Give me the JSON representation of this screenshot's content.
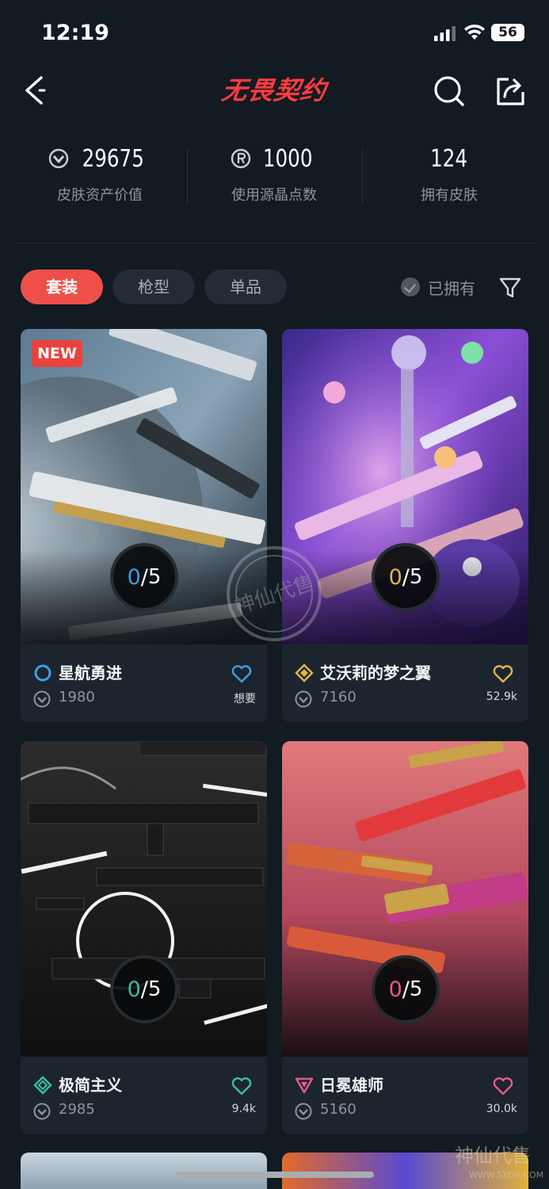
{
  "status_bar": {
    "time": "12:19",
    "battery": "56"
  },
  "header": {
    "title": "无畏契约"
  },
  "stats": [
    {
      "value": "29675",
      "label": "皮肤资产价值",
      "icon": "vp-coin-icon"
    },
    {
      "value": "1000",
      "label": "使用源晶点数",
      "icon": "radianite-icon"
    },
    {
      "value": "124",
      "label": "拥有皮肤",
      "icon": ""
    }
  ],
  "tabs": [
    {
      "label": "套装",
      "active": true
    },
    {
      "label": "枪型",
      "active": false
    },
    {
      "label": "单品",
      "active": false
    }
  ],
  "owned_filter": {
    "label": "已拥有"
  },
  "cards": [
    {
      "name": "星航勇进",
      "price": "1980",
      "owned": "0",
      "total": "5",
      "fav": "想要",
      "badge": "NEW",
      "tier_color": "#3aa0e8",
      "fav_color": "#3aa0e8",
      "count_color": "#3aa0e8"
    },
    {
      "name": "艾沃莉的梦之翼",
      "price": "7160",
      "owned": "0",
      "total": "5",
      "fav": "52.9k",
      "badge": "",
      "tier_color": "#e3b44a",
      "fav_color": "#e3b44a",
      "count_color": "#e3b44a"
    },
    {
      "name": "极简主义",
      "price": "2985",
      "owned": "0",
      "total": "5",
      "fav": "9.4k",
      "badge": "",
      "tier_color": "#38c0a0",
      "fav_color": "#38c0a0",
      "count_color": "#38c0a0"
    },
    {
      "name": "日冕雄师",
      "price": "5160",
      "owned": "0",
      "total": "5",
      "fav": "30.0k",
      "badge": "",
      "tier_color": "#e65a8c",
      "fav_color": "#e65a8c",
      "count_color": "#e65a8c"
    }
  ],
  "watermark": {
    "text": "神仙代售",
    "site": "WWW.SXDS.COM"
  },
  "colors": {
    "accent": "#ee5049",
    "background": "#121a22",
    "card": "#1c252e"
  }
}
